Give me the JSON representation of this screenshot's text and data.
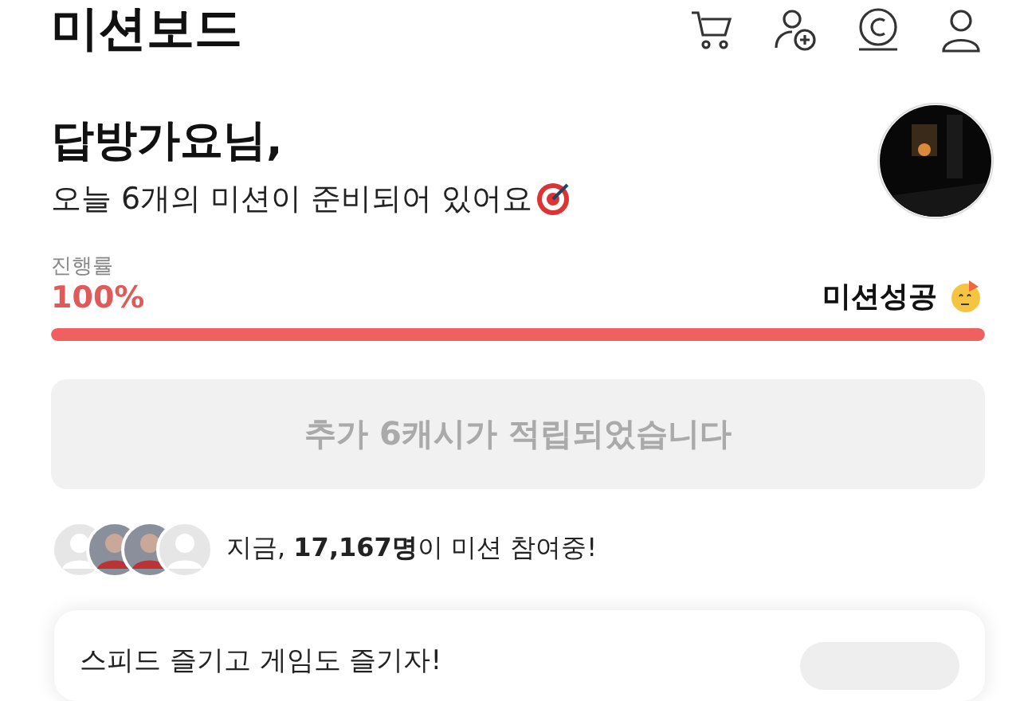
{
  "header": {
    "title": "미션보드"
  },
  "greeting": {
    "name": "답방가요님,",
    "subtitle": "오늘 6개의 미션이 준비되어 있어요"
  },
  "progress": {
    "label": "진행률",
    "percent": "100%",
    "status": "미션성공",
    "level": 1
  },
  "reward_button": {
    "label": "추가 6캐시가 적립되었습니다",
    "disabled": true
  },
  "participants": {
    "prefix": "지금, ",
    "text": "**17,167명**이 미션 참여중!"
  },
  "card": {
    "title": "스피드 즐기고 게임도 즐기자!"
  }
}
